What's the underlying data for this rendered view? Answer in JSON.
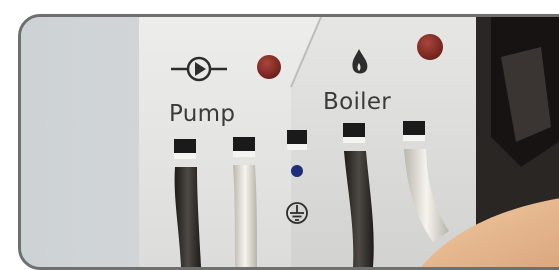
{
  "photo": {
    "labels": {
      "pump": "Pump",
      "boiler": "Boiler"
    },
    "icons": [
      "pump-symbol-icon",
      "flame-icon",
      "ground-icon"
    ],
    "indicator_color": "#8a2b22",
    "panel_color": "#e9e9e7",
    "frame_color": "#6f6f6f"
  }
}
